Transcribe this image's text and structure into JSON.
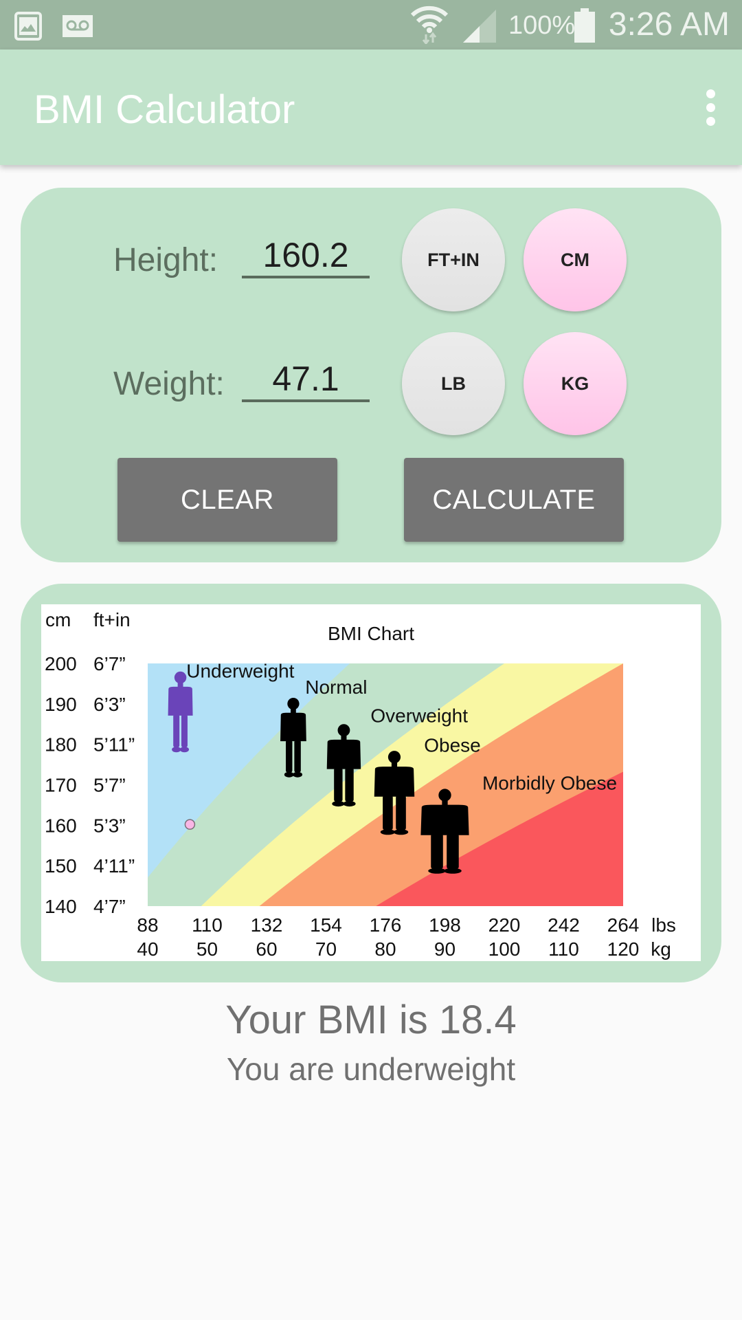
{
  "status_bar": {
    "left_icons": [
      "gallery-icon",
      "voicemail-icon"
    ],
    "right_icons": [
      "wifi-icon",
      "signal-icon",
      "battery-icon"
    ],
    "battery_percent": "100%",
    "time": "3:26 AM"
  },
  "app_bar": {
    "title": "BMI Calculator",
    "menu_icon": "overflow-menu-icon"
  },
  "form": {
    "height_label": "Height:",
    "height_value": "160.2",
    "weight_label": "Weight:",
    "weight_value": "47.1",
    "height_units": [
      {
        "label": "FT+IN",
        "selected": false
      },
      {
        "label": "CM",
        "selected": true
      }
    ],
    "weight_units": [
      {
        "label": "LB",
        "selected": false
      },
      {
        "label": "KG",
        "selected": true
      }
    ],
    "clear_label": "CLEAR",
    "calculate_label": "CALCULATE"
  },
  "colors": {
    "accent_green": "#c1e3cb",
    "status_bar": "#9bb6a0",
    "button_grey": "#747474",
    "unit_selected_pink": "#ffc4e8",
    "underweight": "#b3e1f7",
    "normal": "#c1e3cb",
    "overweight": "#f9f7a3",
    "obese": "#fba06f",
    "morbidly_obese": "#fa575c",
    "marker": "#f9b6e5"
  },
  "chart_data": {
    "type": "area",
    "title": "BMI Chart",
    "y_header_left": "cm",
    "y_header_right": "ft+in",
    "y_ticks": [
      {
        "cm": 200,
        "ftin": "6’7”"
      },
      {
        "cm": 190,
        "ftin": "6’3”"
      },
      {
        "cm": 180,
        "ftin": "5’11”"
      },
      {
        "cm": 170,
        "ftin": "5’7”"
      },
      {
        "cm": 160,
        "ftin": "5’3”"
      },
      {
        "cm": 150,
        "ftin": "4’11”"
      },
      {
        "cm": 140,
        "ftin": "4’7”"
      }
    ],
    "x_ticks": [
      {
        "lbs": 88,
        "kg": 40
      },
      {
        "lbs": 110,
        "kg": 50
      },
      {
        "lbs": 132,
        "kg": 60
      },
      {
        "lbs": 154,
        "kg": 70
      },
      {
        "lbs": 176,
        "kg": 80
      },
      {
        "lbs": 198,
        "kg": 90
      },
      {
        "lbs": 220,
        "kg": 100
      },
      {
        "lbs": 242,
        "kg": 110
      },
      {
        "lbs": 264,
        "kg": 120
      }
    ],
    "x_unit_top": "lbs",
    "x_unit_bottom": "kg",
    "xlim_kg": [
      40,
      120
    ],
    "ylim_cm": [
      140,
      200
    ],
    "bands": [
      {
        "name": "Underweight",
        "bmi_min": 0,
        "bmi_max": 18.5,
        "color": "#b3e1f7"
      },
      {
        "name": "Normal",
        "bmi_min": 18.5,
        "bmi_max": 25,
        "color": "#c1e3cb"
      },
      {
        "name": "Overweight",
        "bmi_min": 25,
        "bmi_max": 30,
        "color": "#f9f7a3"
      },
      {
        "name": "Obese",
        "bmi_min": 30,
        "bmi_max": 40,
        "color": "#fba06f"
      },
      {
        "name": "Morbidly Obese",
        "bmi_min": 40,
        "bmi_max": 999,
        "color": "#fa575c"
      }
    ],
    "labels": [
      {
        "text": "Underweight",
        "kg": 46.5,
        "cm": 196.5
      },
      {
        "text": "Normal",
        "kg": 66.5,
        "cm": 192.5
      },
      {
        "text": "Overweight",
        "kg": 77.5,
        "cm": 185.5
      },
      {
        "text": "Obese",
        "kg": 86.5,
        "cm": 178.2
      },
      {
        "text": "Morbidly Obese",
        "kg": 96.3,
        "cm": 168.8
      }
    ],
    "figures": [
      {
        "category": "Underweight",
        "kg": 45.5,
        "cm_top": 198,
        "cm_bottom": 178.2,
        "width_kg": 4.0,
        "color": "#6a44b9"
      },
      {
        "category": "Normal",
        "kg": 64.5,
        "cm_top": 191.5,
        "cm_bottom": 172.0,
        "width_kg": 4.2,
        "color": "#000000"
      },
      {
        "category": "Overweight",
        "kg": 73.0,
        "cm_top": 185.0,
        "cm_bottom": 164.8,
        "width_kg": 5.5,
        "color": "#000000"
      },
      {
        "category": "Obese",
        "kg": 81.5,
        "cm_top": 178.4,
        "cm_bottom": 157.8,
        "width_kg": 6.5,
        "color": "#000000"
      },
      {
        "category": "Morbidly Obese",
        "kg": 90.0,
        "cm_top": 169.0,
        "cm_bottom": 148.2,
        "width_kg": 7.8,
        "color": "#000000"
      }
    ],
    "marker": {
      "kg": 47.1,
      "cm": 160.2,
      "color": "#f9b6e5"
    }
  },
  "result": {
    "bmi_text": "Your BMI is 18.4",
    "category_text": "You are underweight"
  }
}
